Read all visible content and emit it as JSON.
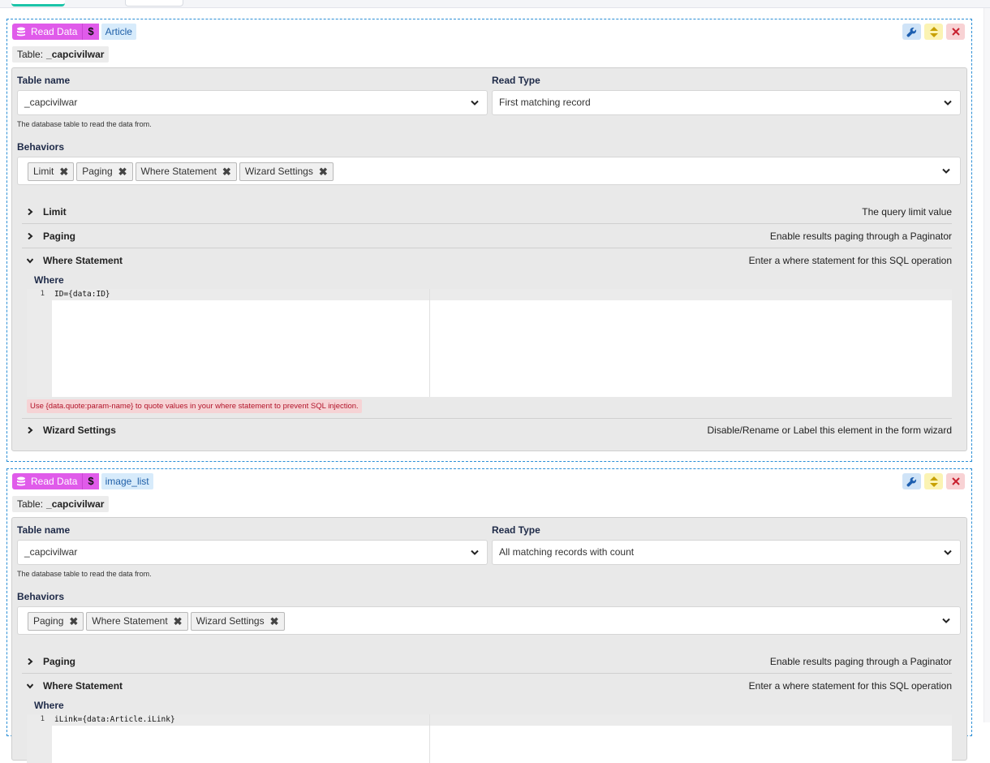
{
  "blocks": [
    {
      "type_label": "Read Data",
      "cost_symbol": "$",
      "name": "Article",
      "table_badge_label": "Table:",
      "table_badge_value": "_capcivilwar",
      "table_name_label": "Table name",
      "table_name_value": "_capcivilwar",
      "table_name_help": "The database table to read the data from.",
      "read_type_label": "Read Type",
      "read_type_value": "First matching record",
      "behaviors_label": "Behaviors",
      "behaviors": [
        "Limit",
        "Paging",
        "Where Statement",
        "Wizard Settings"
      ],
      "sections": [
        {
          "title": "Limit",
          "desc": "The query limit value",
          "expanded": false
        },
        {
          "title": "Paging",
          "desc": "Enable results paging through a Paginator",
          "expanded": false
        },
        {
          "title": "Where Statement",
          "desc": "Enter a where statement for this SQL operation",
          "expanded": true
        },
        {
          "title": "Wizard Settings",
          "desc": "Disable/Rename or Label this element in the form wizard",
          "expanded": false
        }
      ],
      "where_label": "Where",
      "where_line_no": "1",
      "where_code": "ID={data:ID}",
      "where_warning": "Use {data.quote:param-name} to quote values in your where statement to prevent SQL injection."
    },
    {
      "type_label": "Read Data",
      "cost_symbol": "$",
      "name": "image_list",
      "table_badge_label": "Table:",
      "table_badge_value": "_capcivilwar",
      "table_name_label": "Table name",
      "table_name_value": "_capcivilwar",
      "table_name_help": "The database table to read the data from.",
      "read_type_label": "Read Type",
      "read_type_value": "All matching records with count",
      "behaviors_label": "Behaviors",
      "behaviors": [
        "Paging",
        "Where Statement",
        "Wizard Settings"
      ],
      "sections": [
        {
          "title": "Paging",
          "desc": "Enable results paging through a Paginator",
          "expanded": false
        },
        {
          "title": "Where Statement",
          "desc": "Enter a where statement for this SQL operation",
          "expanded": true
        }
      ],
      "where_label": "Where",
      "where_line_no": "1",
      "where_code": "iLink={data:Article.iLink}"
    }
  ],
  "icons": {
    "type": "database-icon",
    "settings": "wrench-icon",
    "reorder": "sort-icon",
    "remove": "close-icon",
    "dropdown": "chevron-down-icon",
    "collapsed": "chevron-right-icon",
    "expanded": "chevron-down-icon",
    "chip_remove": "x-icon"
  },
  "colors": {
    "read_tag": "#e05bea",
    "name_tag_bg": "#d7ebfb",
    "block_border": "#2b8fd6",
    "warning_bg": "#f6d3d5",
    "warning_text": "#b2142a"
  }
}
